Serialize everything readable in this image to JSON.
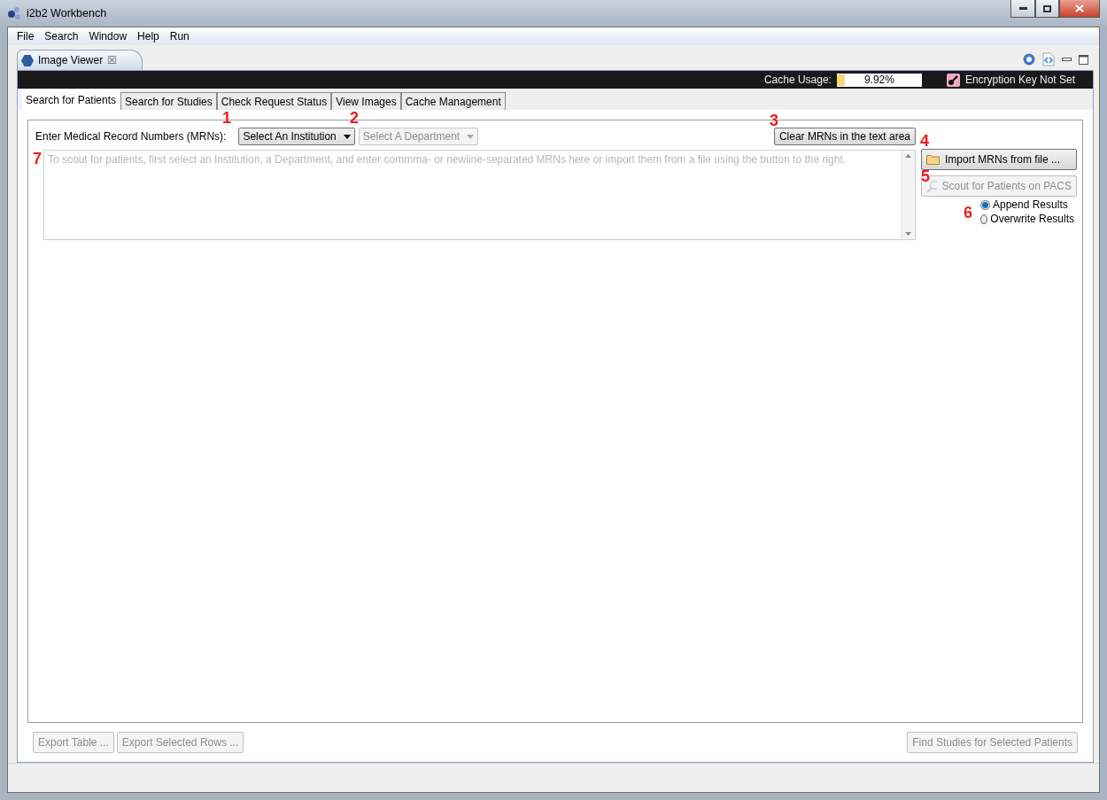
{
  "window": {
    "title": "i2b2 Workbench"
  },
  "menu": [
    {
      "label": "File"
    },
    {
      "label": "Search"
    },
    {
      "label": "Window"
    },
    {
      "label": "Help"
    },
    {
      "label": "Run"
    }
  ],
  "view_tab": {
    "label": "Image Viewer",
    "close": "☒"
  },
  "status_strip": {
    "cache_label": "Cache Usage:",
    "cache_reading": "9.92%",
    "level": 0.0992,
    "encryption": "Encryption Key Not Set"
  },
  "tabs": [
    {
      "label": "Search for Patients",
      "selected": true
    },
    {
      "label": "Search for Studies",
      "selected": false
    },
    {
      "label": "Check Request Status",
      "selected": false
    },
    {
      "label": "View Images",
      "selected": false
    },
    {
      "label": "Cache Management",
      "selected": false
    }
  ],
  "form": {
    "mrn_label": "Enter Medical Record Numbers (MRNs):",
    "institution": {
      "value": "Select An Institution",
      "disabled": false
    },
    "department": {
      "value": "Select A Department",
      "disabled": true
    },
    "clear_button": "Clear MRNs in the text area",
    "mrn_area": {
      "placeholder": "To scout for patients, first select an Institution, a Department, and enter commma- or newline-separated MRNs here or import them from a file using the button to the right."
    },
    "import_button": {
      "label": "Import MRNs from file ...",
      "disabled": false
    },
    "scout_button": {
      "label": "Scout for Patients on PACS",
      "disabled": true
    },
    "result_mode": [
      {
        "label": "Append Results",
        "selected": true
      },
      {
        "label": "Overwrite Results",
        "selected": false
      }
    ]
  },
  "bottom_buttons": [
    {
      "label": "Export Table ...",
      "disabled": true
    },
    {
      "label": "Export Selected Rows ...",
      "disabled": true
    },
    {
      "label": "Find Studies for Selected Patients",
      "disabled": true
    }
  ],
  "annotations": [
    {
      "label": "1"
    },
    {
      "label": "2"
    },
    {
      "label": "3"
    },
    {
      "label": "4"
    },
    {
      "label": "5"
    },
    {
      "label": "6"
    },
    {
      "label": "7"
    }
  ]
}
